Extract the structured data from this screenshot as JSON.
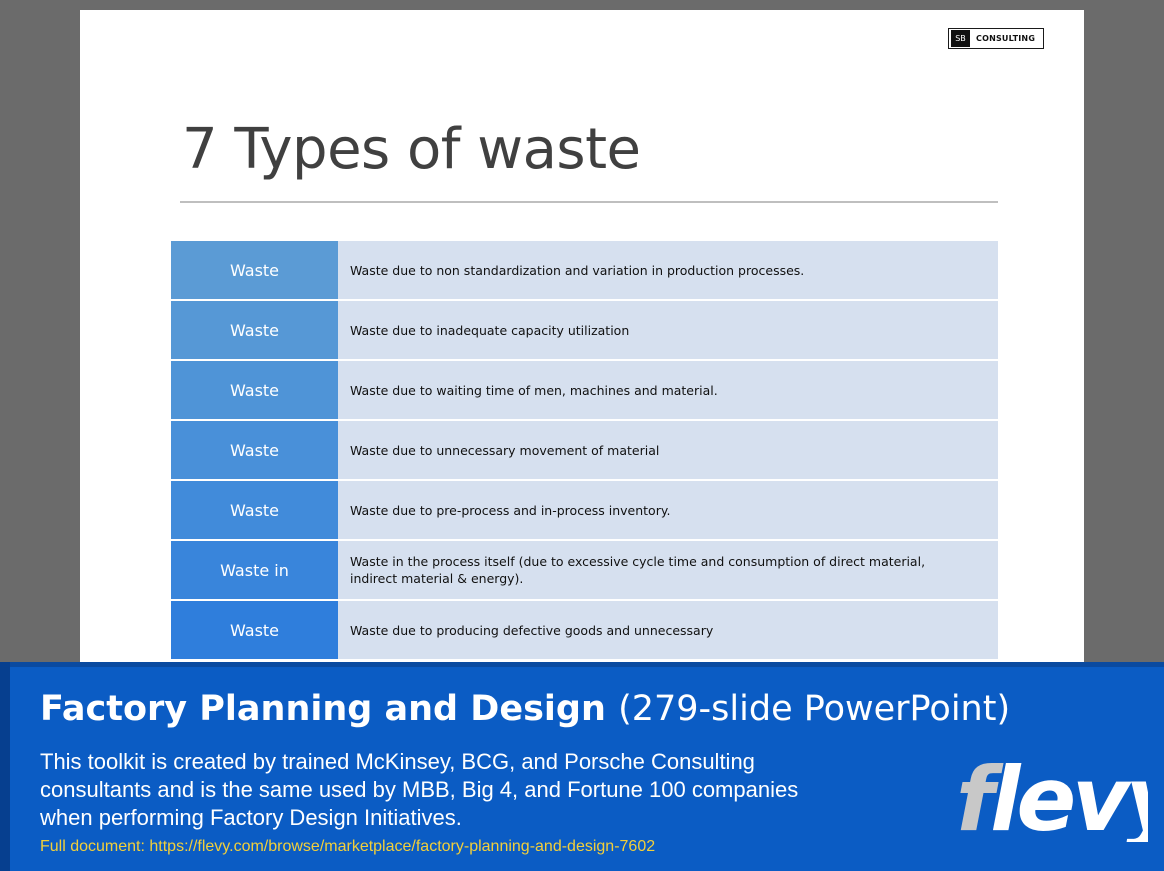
{
  "slide": {
    "logo": {
      "mark": "SB",
      "text": "CONSULTING"
    },
    "title": "7 Types of waste",
    "rows": [
      {
        "label": "Waste",
        "desc": "Waste due to non standardization and variation in production processes.",
        "color": "#5b9bd5"
      },
      {
        "label": "Waste",
        "desc": "Waste due to inadequate capacity utilization",
        "color": "#5698d6"
      },
      {
        "label": "Waste",
        "desc": "Waste due to waiting time of men, machines and material.",
        "color": "#4f94d7"
      },
      {
        "label": "Waste",
        "desc": "Waste due to unnecessary movement of material",
        "color": "#4990d9"
      },
      {
        "label": "Waste",
        "desc": "Waste due to pre-process and in-process inventory.",
        "color": "#418bda"
      },
      {
        "label": "Waste in",
        "desc": "Waste in the process itself (due to excessive cycle time and consumption of direct material, indirect material & energy).",
        "color": "#3985db"
      },
      {
        "label": "Waste",
        "desc": "Waste due to producing defective goods and unnecessary",
        "color": "#2f7edc"
      }
    ]
  },
  "banner": {
    "title_bold": "Factory Planning and Design",
    "title_light": "(279-slide PowerPoint)",
    "description": "This toolkit is created by trained McKinsey, BCG, and Porsche Consulting consultants and is the same used by MBB, Big 4, and Fortune 100 companies when performing Factory Design Initiatives.",
    "link": "Full document: https://flevy.com/browse/marketplace/factory-planning-and-design-7602",
    "brand": "flevy"
  },
  "colors": {
    "banner_bg": "#0b5cc4",
    "link": "#f2cf3a",
    "desc_bg": "#d6e0ef",
    "brand_f": "#c8c8c8",
    "brand_rest": "#ffffff"
  }
}
